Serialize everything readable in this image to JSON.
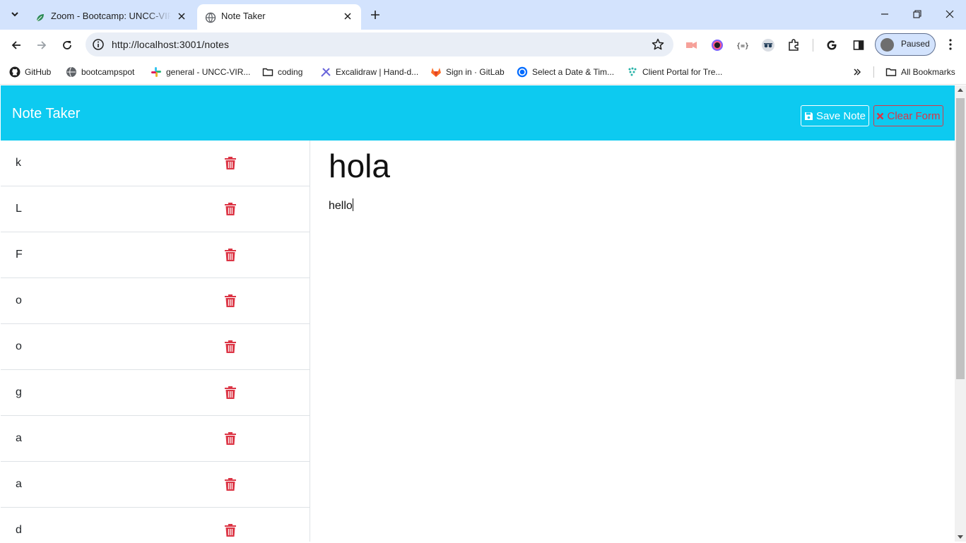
{
  "browser": {
    "tabs": [
      {
        "title": "Zoom - Bootcamp: UNCC-VIRT-",
        "icon": "zoom-leaf-icon",
        "active": false
      },
      {
        "title": "Note Taker",
        "icon": "globe-icon",
        "active": true
      }
    ],
    "url": "http://localhost:3001/notes",
    "profile_label": "Paused",
    "bookmarks": [
      {
        "label": "GitHub",
        "icon": "github-icon"
      },
      {
        "label": "bootcampspot",
        "icon": "globe-icon"
      },
      {
        "label": "general - UNCC-VIR...",
        "icon": "slack-icon"
      },
      {
        "label": "coding",
        "icon": "folder-icon"
      },
      {
        "label": "Excalidraw | Hand-d...",
        "icon": "excalidraw-icon"
      },
      {
        "label": "Sign in · GitLab",
        "icon": "gitlab-icon"
      },
      {
        "label": "Select a Date & Tim...",
        "icon": "calendly-icon"
      },
      {
        "label": "Client Portal for Tre...",
        "icon": "dots-icon"
      }
    ],
    "all_bookmarks_label": "All Bookmarks"
  },
  "app": {
    "brand": "Note Taker",
    "save_label": "Save Note",
    "clear_label": "Clear Form",
    "colors": {
      "navbar": "#0dcaf0",
      "danger": "#dc3545"
    }
  },
  "notes": [
    {
      "title": "k"
    },
    {
      "title": "L"
    },
    {
      "title": "F"
    },
    {
      "title": "o"
    },
    {
      "title": "o"
    },
    {
      "title": "g"
    },
    {
      "title": "a"
    },
    {
      "title": "a"
    },
    {
      "title": "d"
    }
  ],
  "active_note": {
    "title": "hola",
    "text": "hello"
  }
}
